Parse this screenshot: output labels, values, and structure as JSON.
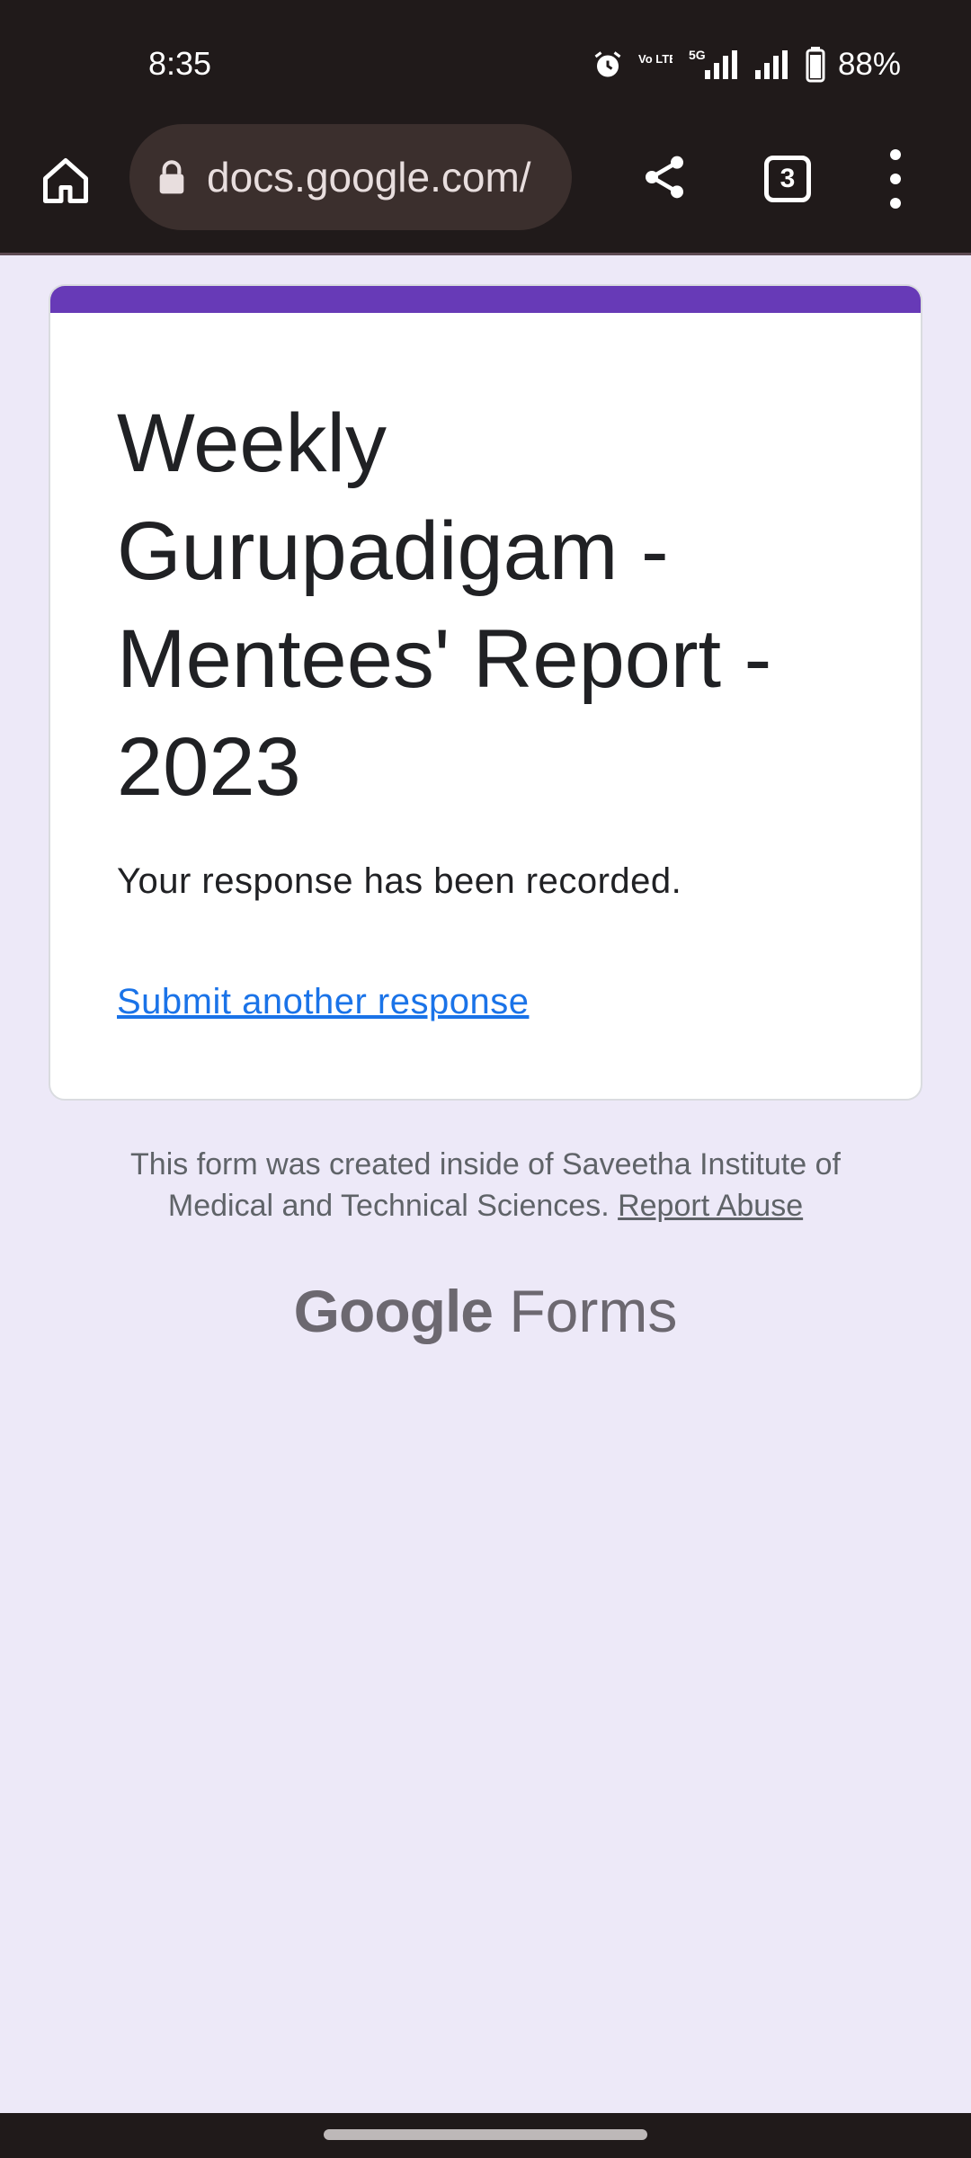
{
  "status_bar": {
    "time": "8:35",
    "icons": [
      "alarm-icon",
      "volte-icon",
      "signal-5g-icon",
      "signal-icon",
      "battery-icon"
    ],
    "volte_label": "Vo LTE2",
    "network_label": "5G",
    "battery_percent": "88%"
  },
  "toolbar": {
    "url": "docs.google.com/",
    "tab_count": "3"
  },
  "form": {
    "accent_color": "#673ab7",
    "title": "Weekly Gurupadigam - Mentees' Report - 2023",
    "confirmation": "Your response has been recorded.",
    "submit_another": "Submit another response"
  },
  "footer": {
    "created_text": "This form was created inside of Saveetha Institute of Medical and Technical Sciences.",
    "report_abuse": "Report Abuse",
    "brand_google": "Google",
    "brand_forms": "Forms"
  }
}
